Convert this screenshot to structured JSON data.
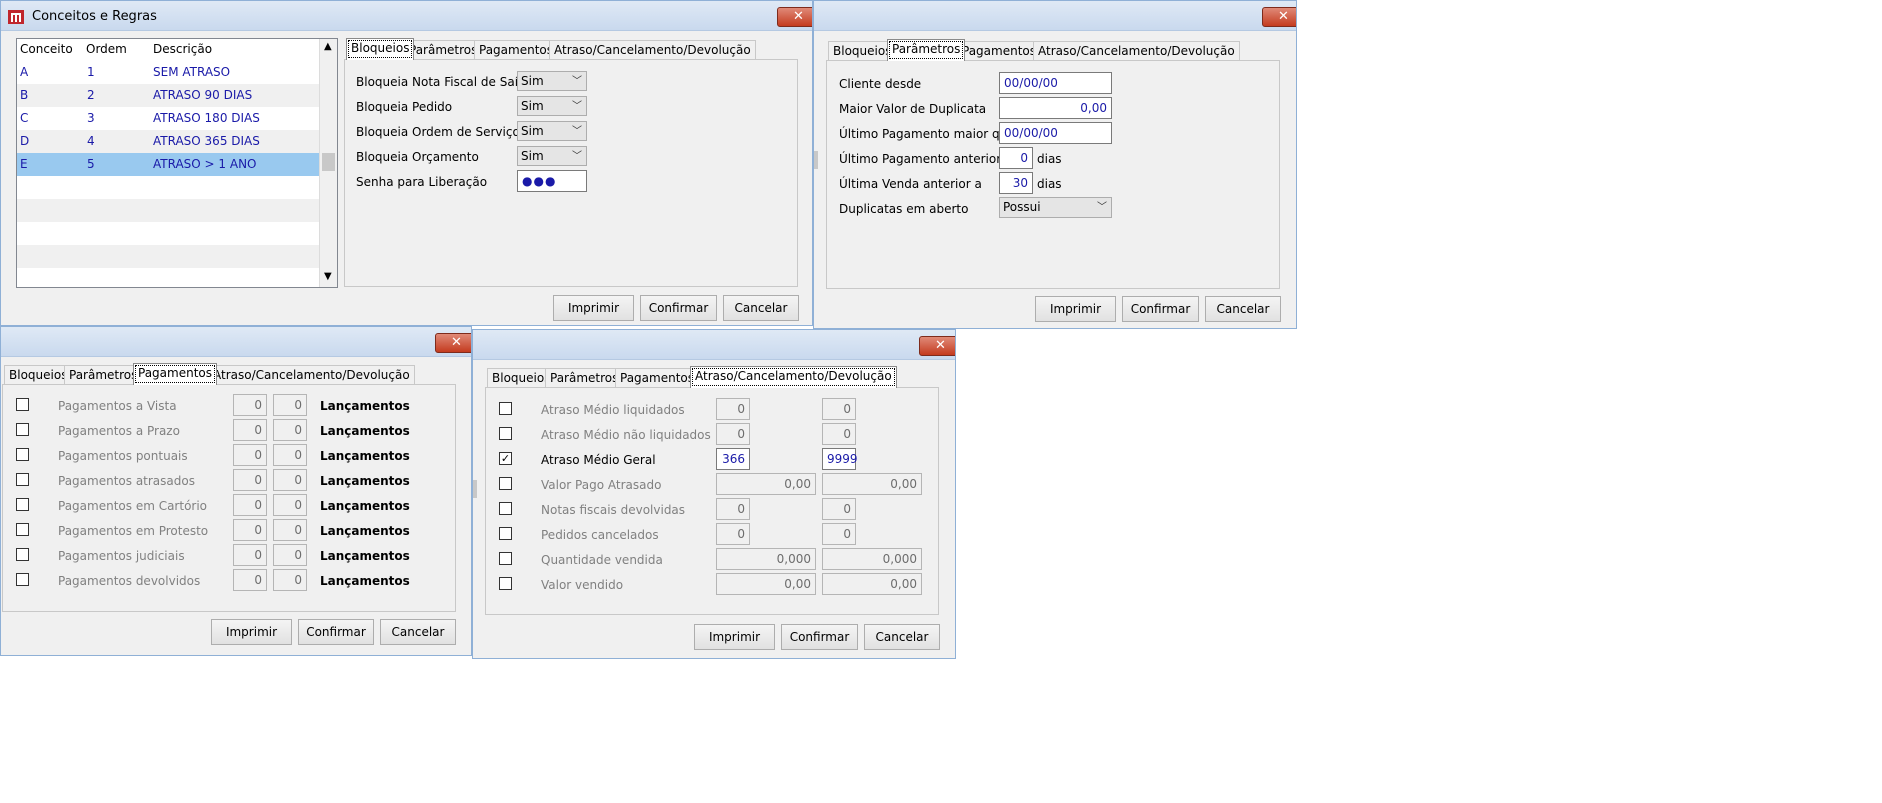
{
  "colors": {
    "titlebar": "#c9d9ee",
    "close": "#c43b1f",
    "selection": "#99c9ef",
    "value_text": "#1a1aa8"
  },
  "main_window": {
    "title": "Conceitos e Regras",
    "grid": {
      "headers": [
        "Conceito",
        "Ordem",
        "Descrição"
      ],
      "rows": [
        [
          "A",
          "1",
          "SEM ATRASO"
        ],
        [
          "B",
          "2",
          "ATRASO 90 DIAS"
        ],
        [
          "C",
          "3",
          "ATRASO 180 DIAS"
        ],
        [
          "D",
          "4",
          "ATRASO 365 DIAS"
        ],
        [
          "E",
          "5",
          "ATRASO > 1 ANO"
        ]
      ],
      "selected_index": 4
    },
    "tabs": [
      "Bloqueios",
      "Parâmetros",
      "Pagamentos",
      "Atraso/Cancelamento/Devolução"
    ],
    "active_tab": "Bloqueios",
    "bloqueios": {
      "rows": [
        {
          "label": "Bloqueia Nota Fiscal de Saída",
          "value": "Sim"
        },
        {
          "label": "Bloqueia Pedido",
          "value": "Sim"
        },
        {
          "label": "Bloqueia Ordem de Serviço",
          "value": "Sim"
        },
        {
          "label": "Bloqueia Orçamento",
          "value": "Sim"
        }
      ],
      "password_label": "Senha para Liberação",
      "password_value": "●●●"
    },
    "buttons": {
      "print": "Imprimir",
      "confirm": "Confirmar",
      "cancel": "Cancelar"
    }
  },
  "parametros_window": {
    "tabs": [
      "Bloqueios",
      "Parâmetros",
      "Pagamentos",
      "Atraso/Cancelamento/Devolução"
    ],
    "active_tab": "Parâmetros",
    "rows": [
      {
        "label": "Cliente desde",
        "value": "00/00/00"
      },
      {
        "label": "Maior Valor de Duplicata",
        "value": "0,00"
      },
      {
        "label": "Último Pagamento maior que",
        "value": "00/00/00"
      },
      {
        "label": "Último Pagamento anterior a",
        "value": "0",
        "unit": "dias"
      },
      {
        "label": "Última Venda anterior a",
        "value": "30",
        "unit": "dias"
      },
      {
        "label": "Duplicatas em aberto",
        "value": "Possui"
      }
    ],
    "buttons": {
      "print": "Imprimir",
      "confirm": "Confirmar",
      "cancel": "Cancelar"
    }
  },
  "pagamentos_window": {
    "tabs": [
      "Bloqueios",
      "Parâmetros",
      "Pagamentos",
      "Atraso/Cancelamento/Devolução"
    ],
    "active_tab": "Pagamentos",
    "rows": [
      {
        "label": "Pagamentos a Vista",
        "v1": "0",
        "v2": "0",
        "suffix": "Lançamentos",
        "checked": false
      },
      {
        "label": "Pagamentos a Prazo",
        "v1": "0",
        "v2": "0",
        "suffix": "Lançamentos",
        "checked": false
      },
      {
        "label": "Pagamentos pontuais",
        "v1": "0",
        "v2": "0",
        "suffix": "Lançamentos",
        "checked": false
      },
      {
        "label": "Pagamentos atrasados",
        "v1": "0",
        "v2": "0",
        "suffix": "Lançamentos",
        "checked": false
      },
      {
        "label": "Pagamentos em Cartório",
        "v1": "0",
        "v2": "0",
        "suffix": "Lançamentos",
        "checked": false
      },
      {
        "label": "Pagamentos em Protesto",
        "v1": "0",
        "v2": "0",
        "suffix": "Lançamentos",
        "checked": false
      },
      {
        "label": "Pagamentos judiciais",
        "v1": "0",
        "v2": "0",
        "suffix": "Lançamentos",
        "checked": false
      },
      {
        "label": "Pagamentos devolvidos",
        "v1": "0",
        "v2": "0",
        "suffix": "Lançamentos",
        "checked": false
      }
    ],
    "buttons": {
      "print": "Imprimir",
      "confirm": "Confirmar",
      "cancel": "Cancelar"
    }
  },
  "atraso_window": {
    "tabs": [
      "Bloqueios",
      "Parâmetros",
      "Pagamentos",
      "Atraso/Cancelamento/Devolução"
    ],
    "active_tab": "Atraso/Cancelamento/Devolução",
    "rows": [
      {
        "label": "Atraso Médio liquidados",
        "v1": "0",
        "v2": "0",
        "checked": false
      },
      {
        "label": "Atraso Médio não liquidados",
        "v1": "0",
        "v2": "0",
        "checked": false
      },
      {
        "label": "Atraso Médio Geral",
        "v1": "366",
        "v2": "9999",
        "checked": true
      },
      {
        "label": "Valor Pago Atrasado",
        "v1": "0,00",
        "v2": "0,00",
        "checked": false
      },
      {
        "label": "Notas fiscais devolvidas",
        "v1": "0",
        "v2": "0",
        "checked": false
      },
      {
        "label": "Pedidos cancelados",
        "v1": "0",
        "v2": "0",
        "checked": false
      },
      {
        "label": "Quantidade vendida",
        "v1": "0,000",
        "v2": "0,000",
        "checked": false
      },
      {
        "label": "Valor vendido",
        "v1": "0,00",
        "v2": "0,00",
        "checked": false
      }
    ],
    "buttons": {
      "print": "Imprimir",
      "confirm": "Confirmar",
      "cancel": "Cancelar"
    }
  }
}
